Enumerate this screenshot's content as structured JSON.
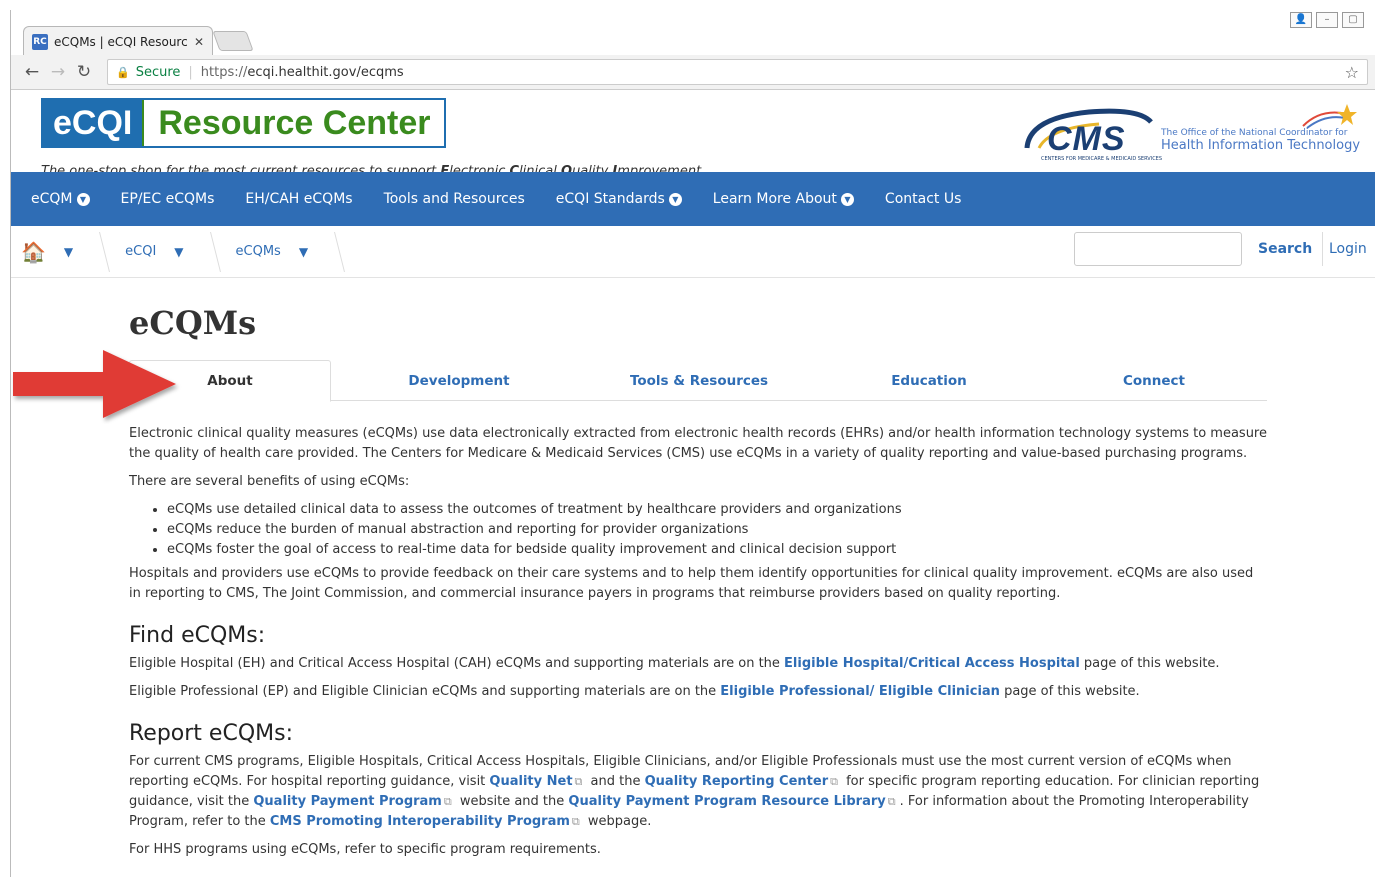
{
  "browser": {
    "tab_title": "eCQMs | eCQI Resource C",
    "tab_favicon": "RC",
    "secure_label": "Secure",
    "url_scheme": "https://",
    "url_rest": "ecqi.healthit.gov/ecqms"
  },
  "header": {
    "logo_left": "eCQI",
    "logo_right": "Resource Center",
    "tagline_parts": [
      "The one-stop shop for the most current resources to support ",
      "E",
      "lectronic ",
      "C",
      "linical ",
      "Q",
      "uality ",
      "I",
      "mprovement."
    ],
    "cms_logo": "CMS",
    "cms_sub": "CENTERS FOR MEDICARE & MEDICAID SERVICES",
    "onc_line1": "The Office of the National Coordinator for",
    "onc_line2": "Health Information Technology"
  },
  "nav": {
    "items": [
      {
        "label": "eCQM",
        "has_caret": true
      },
      {
        "label": "EP/EC eCQMs",
        "has_caret": false
      },
      {
        "label": "EH/CAH eCQMs",
        "has_caret": false
      },
      {
        "label": "Tools and Resources",
        "has_caret": false
      },
      {
        "label": "eCQI Standards",
        "has_caret": true
      },
      {
        "label": "Learn More About",
        "has_caret": true
      },
      {
        "label": "Contact Us",
        "has_caret": false
      }
    ]
  },
  "breadcrumb": {
    "crumb1": "eCQI",
    "crumb2": "eCQMs",
    "search_label": "Search",
    "login_label": "Login"
  },
  "page": {
    "title": "eCQMs",
    "tabs": [
      "About",
      "Development",
      "Tools & Resources",
      "Education",
      "Connect"
    ],
    "active_tab": "About"
  },
  "content": {
    "intro": "Electronic clinical quality measures (eCQMs) use data electronically extracted from electronic health records (EHRs) and/or health information technology systems to measure the quality of health care provided. The Centers for Medicare & Medicaid Services (CMS) use eCQMs in a variety of quality reporting and value-based purchasing programs.",
    "benefits_intro": "There are several benefits of using eCQMs:",
    "benefits": [
      "eCQMs use detailed clinical data to assess the outcomes of treatment by healthcare providers and organizations",
      "eCQMs reduce the burden of manual abstraction and reporting for provider organizations",
      "eCQMs foster the goal of access to real-time data for bedside quality improvement and clinical decision support"
    ],
    "hospitals_para": "Hospitals and providers use eCQMs to provide feedback on their care systems and to help them identify opportunities for clinical quality improvement. eCQMs are also used in reporting to CMS, The Joint Commission, and commercial insurance payers in programs that reimburse providers based on quality reporting.",
    "find_heading": "Find eCQMs:",
    "find_eh_pre": "Eligible Hospital (EH) and Critical Access Hospital (CAH) eCQMs and supporting materials are on the ",
    "find_eh_link": "Eligible Hospital/Critical Access Hospital",
    "find_eh_post": " page of this website.",
    "find_ep_pre": "Eligible Professional (EP) and Eligible Clinician eCQMs and supporting materials are on the ",
    "find_ep_link": "Eligible Professional/ Eligible Clinician",
    "find_ep_post": " page of this website.",
    "report_heading": "Report eCQMs:",
    "report_1": "For current CMS programs, Eligible Hospitals, Critical Access Hospitals, Eligible Clinicians, and/or Eligible Professionals must use the most current version of eCQMs when reporting eCQMs. For hospital reporting guidance, visit ",
    "report_link_qnet": "Quality Net",
    "report_2": " and the ",
    "report_link_qrc": "Quality Reporting Center",
    "report_3": " for specific program reporting education. For clinician reporting guidance, visit the ",
    "report_link_qpp": "Quality Payment Program",
    "report_4": " website and the ",
    "report_link_qpprl": "Quality Payment Program Resource Library",
    "report_5": ". For information about the Promoting Interoperability Program, refer to the ",
    "report_link_pi": "CMS Promoting Interoperability Program",
    "report_6": " webpage.",
    "hhs_para": "For HHS programs using eCQMs, refer to specific program requirements."
  },
  "colors": {
    "nav_blue": "#2f6db5",
    "logo_green": "#3a8b1e",
    "arrow_red": "#e03a36"
  }
}
